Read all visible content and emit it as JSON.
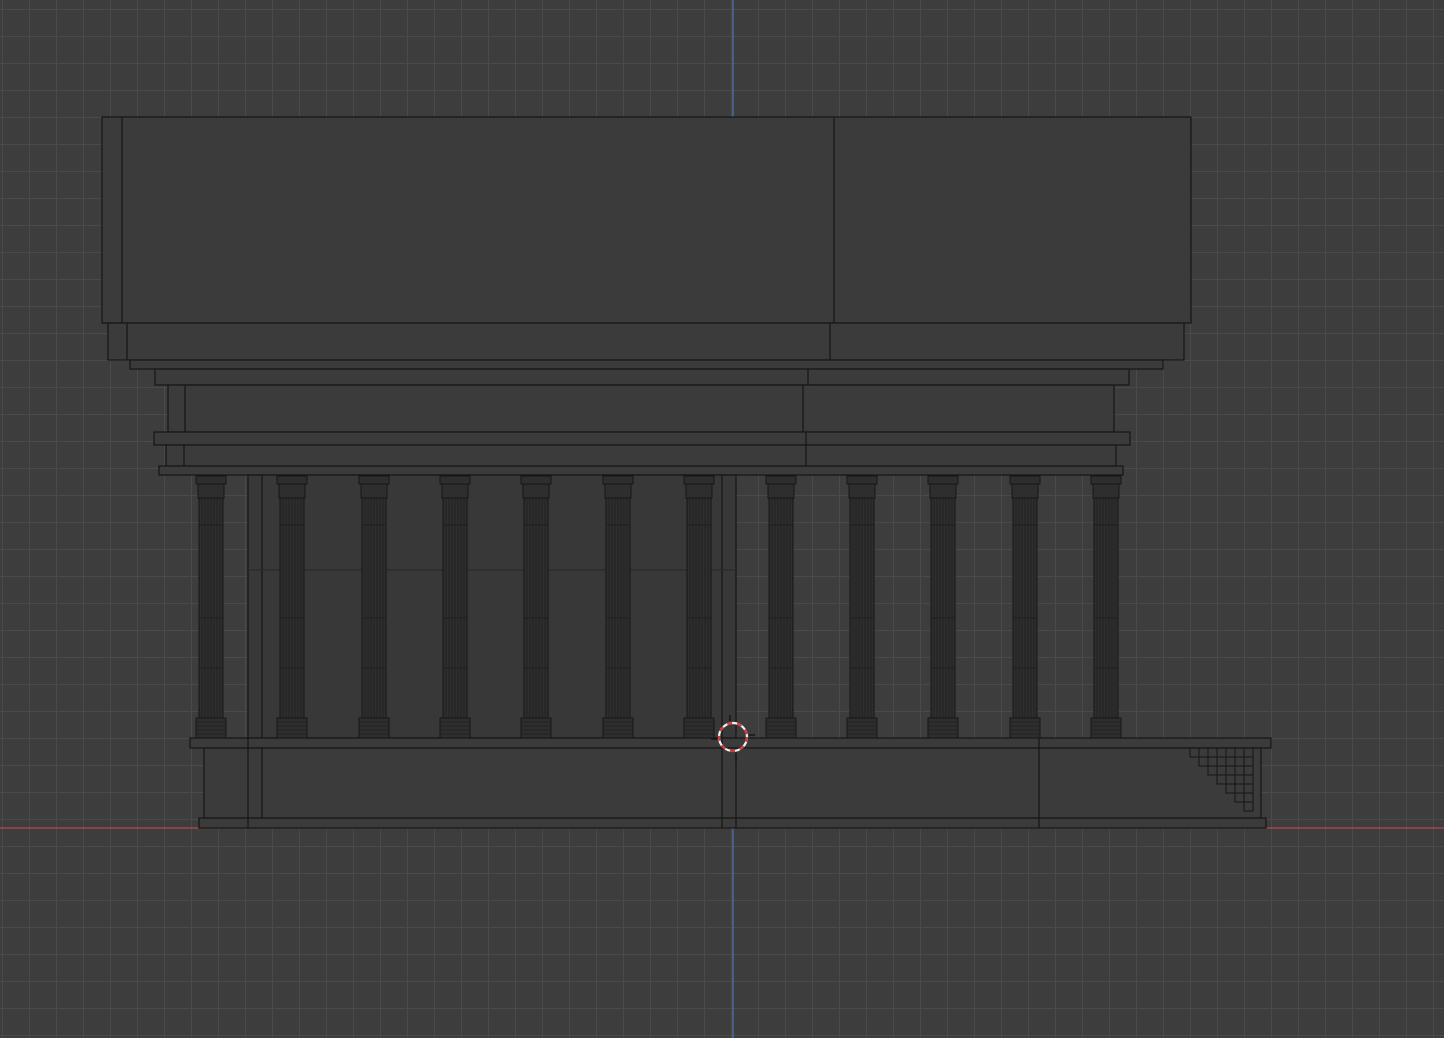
{
  "viewport": {
    "view": "front-orthographic",
    "shading": "wireframe",
    "grid_visible": true
  },
  "colors": {
    "background": "#3d3d3d",
    "grid_line": "#4a4a4a",
    "x_axis": "#b54a4a",
    "z_axis": "#4a78b0",
    "mesh_fill": "#3b3b3b",
    "mesh_edge": "#161616",
    "column_fill": "#2e2e2e",
    "cursor_red": "#d23a3a",
    "cursor_white": "#f0f0f0"
  },
  "model": {
    "object": "temple",
    "column_count": 12
  },
  "icons": {
    "cursor": "3d-cursor-icon"
  }
}
